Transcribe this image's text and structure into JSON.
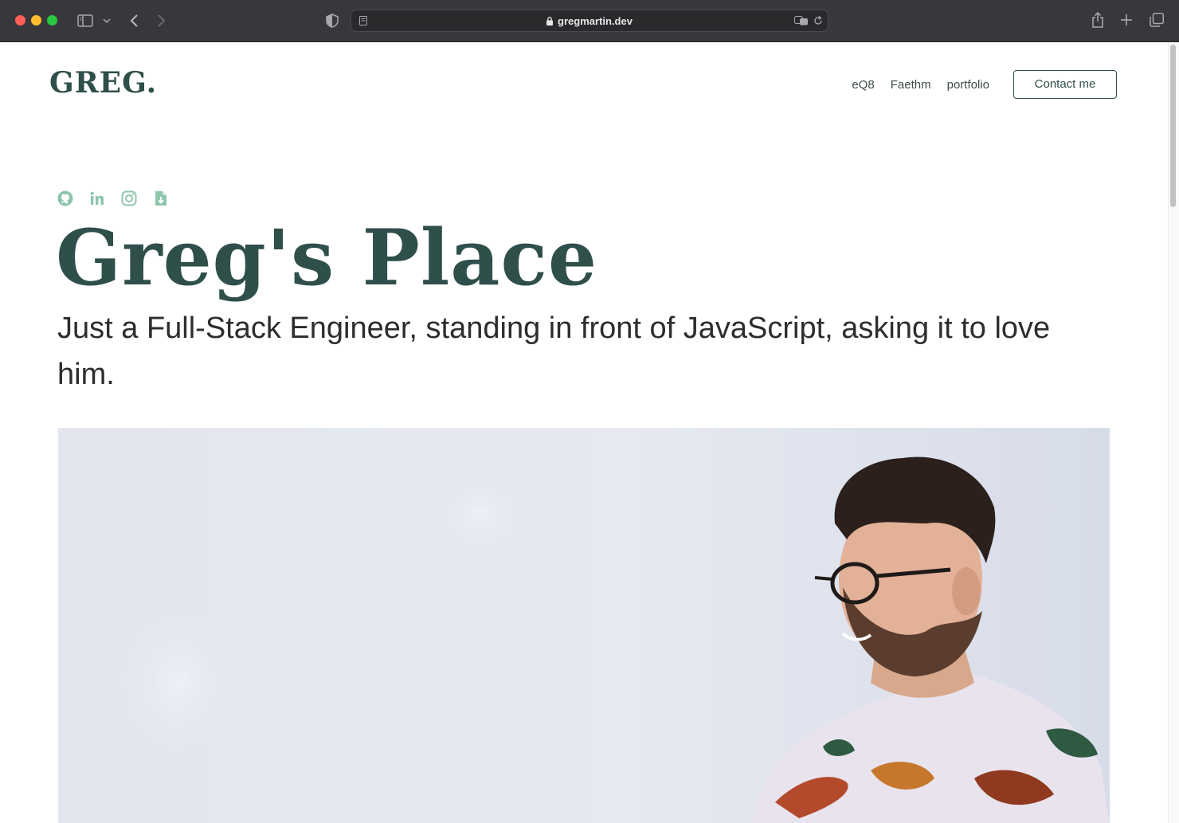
{
  "browser": {
    "url": "gregmartin.dev"
  },
  "site": {
    "logo": "GREG.",
    "nav": [
      {
        "label": "eQ8"
      },
      {
        "label": "Faethm"
      },
      {
        "label": "portfolio"
      }
    ],
    "contact_label": "Contact me",
    "socials": [
      "github-icon",
      "linkedin-icon",
      "instagram-icon",
      "resume-download-icon"
    ],
    "hero_title": "Greg's Place",
    "hero_subtitle": "Just a Full-Stack Engineer, standing in front of JavaScript, asking it to love him.",
    "accent_color": "#2f4f4a",
    "social_icon_color": "#8ec5ad"
  }
}
